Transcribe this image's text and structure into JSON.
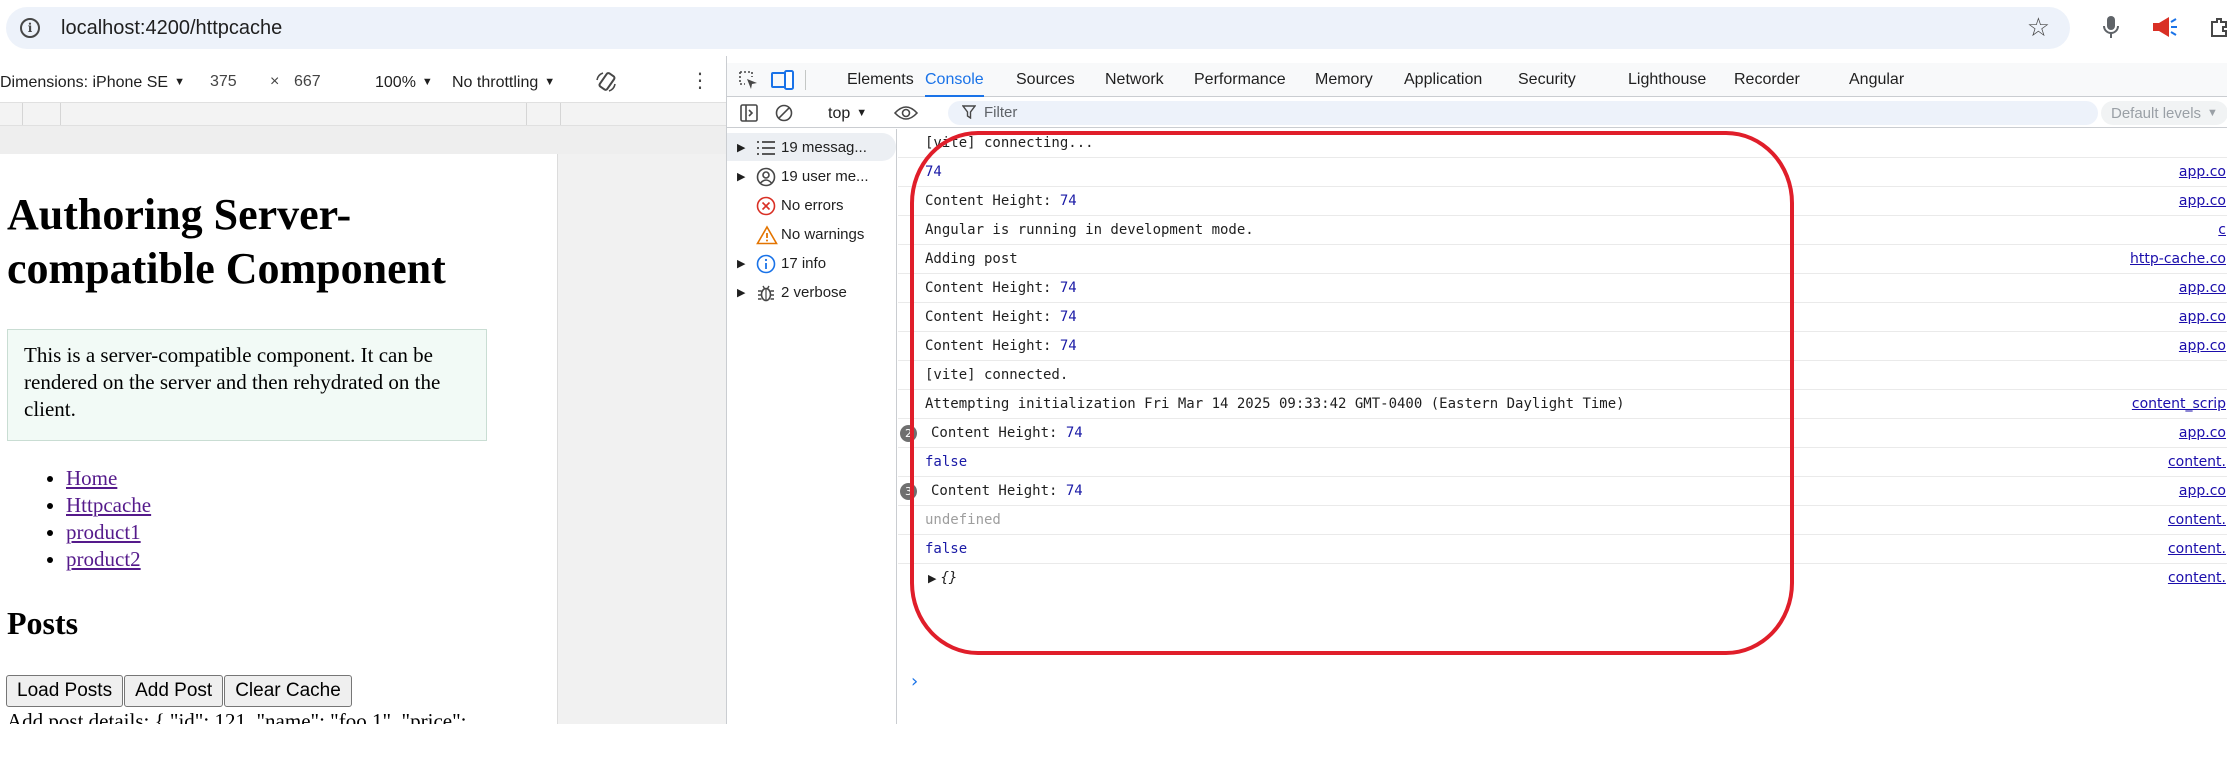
{
  "browser": {
    "url": "localhost:4200/httpcache",
    "icons": [
      "site-info-icon",
      "bookmark-star-icon",
      "microphone-icon",
      "megaphone-icon",
      "extensions-icon"
    ]
  },
  "device_toolbar": {
    "device_label": "Dimensions: iPhone SE",
    "width": "375",
    "times": "×",
    "height": "667",
    "zoom": "100%",
    "throttling": "No throttling"
  },
  "page": {
    "title": "Authoring Server-compatible Component",
    "info_text": "This is a server-compatible component. It can be rendered on the server and then rehydrated on the client.",
    "nav_links": [
      "Home",
      "Httpcache",
      "product1",
      "product2"
    ],
    "posts_heading": "Posts",
    "buttons": {
      "load": "Load Posts",
      "add": "Add Post",
      "clear": "Clear Cache"
    },
    "post_details": "Add post details: { \"id\": 121, \"name\": \"foo 1\", \"price\":"
  },
  "devtools": {
    "tabs": [
      "Elements",
      "Console",
      "Sources",
      "Network",
      "Performance",
      "Memory",
      "Application",
      "Security",
      "Lighthouse",
      "Recorder",
      "Angular"
    ],
    "active_tab": "Console",
    "context": "top",
    "filter_placeholder": "Filter",
    "levels": "Default levels",
    "sidebar": [
      {
        "label": "19 messag...",
        "icon": "list-icon"
      },
      {
        "label": "19 user me...",
        "icon": "user-icon"
      },
      {
        "label": "No errors",
        "icon": "error-icon"
      },
      {
        "label": "No warnings",
        "icon": "warning-icon"
      },
      {
        "label": "17 info",
        "icon": "info-icon"
      },
      {
        "label": "2 verbose",
        "icon": "bug-icon"
      }
    ],
    "messages": [
      {
        "text": "[vite] connecting...",
        "src": ""
      },
      {
        "text": "74",
        "src": "app.co"
      },
      {
        "text": "Content Height: ",
        "num": "74",
        "src": "app.co"
      },
      {
        "text": "Angular is running in development mode.",
        "src": "c"
      },
      {
        "text": "Adding post",
        "src": "http-cache.co"
      },
      {
        "text": "Content Height: ",
        "num": "74",
        "src": "app.co"
      },
      {
        "text": "Content Height: ",
        "num": "74",
        "src": "app.co"
      },
      {
        "text": "Content Height: ",
        "num": "74",
        "src": "app.co"
      },
      {
        "text": "[vite] connected.",
        "src": ""
      },
      {
        "text": "Attempting initialization Fri Mar 14 2025 09:33:42 GMT-0400 (Eastern Daylight Time)",
        "src": "content_scrip"
      },
      {
        "badge": "2",
        "text": "Content Height: ",
        "num": "74",
        "src": "app.co"
      },
      {
        "text": "false",
        "src": "content."
      },
      {
        "badge": "3",
        "text": "Content Height: ",
        "num": "74",
        "src": "app.co"
      },
      {
        "text": "undefined",
        "src": "content."
      },
      {
        "text": "false",
        "src": "content."
      },
      {
        "text": "{}",
        "src": "content."
      }
    ],
    "prompt": "›"
  },
  "colors": {
    "accent": "#1a73e8",
    "annotation": "#e01e2a",
    "link": "#1a0dab",
    "console_number": "#1a1aa6"
  }
}
